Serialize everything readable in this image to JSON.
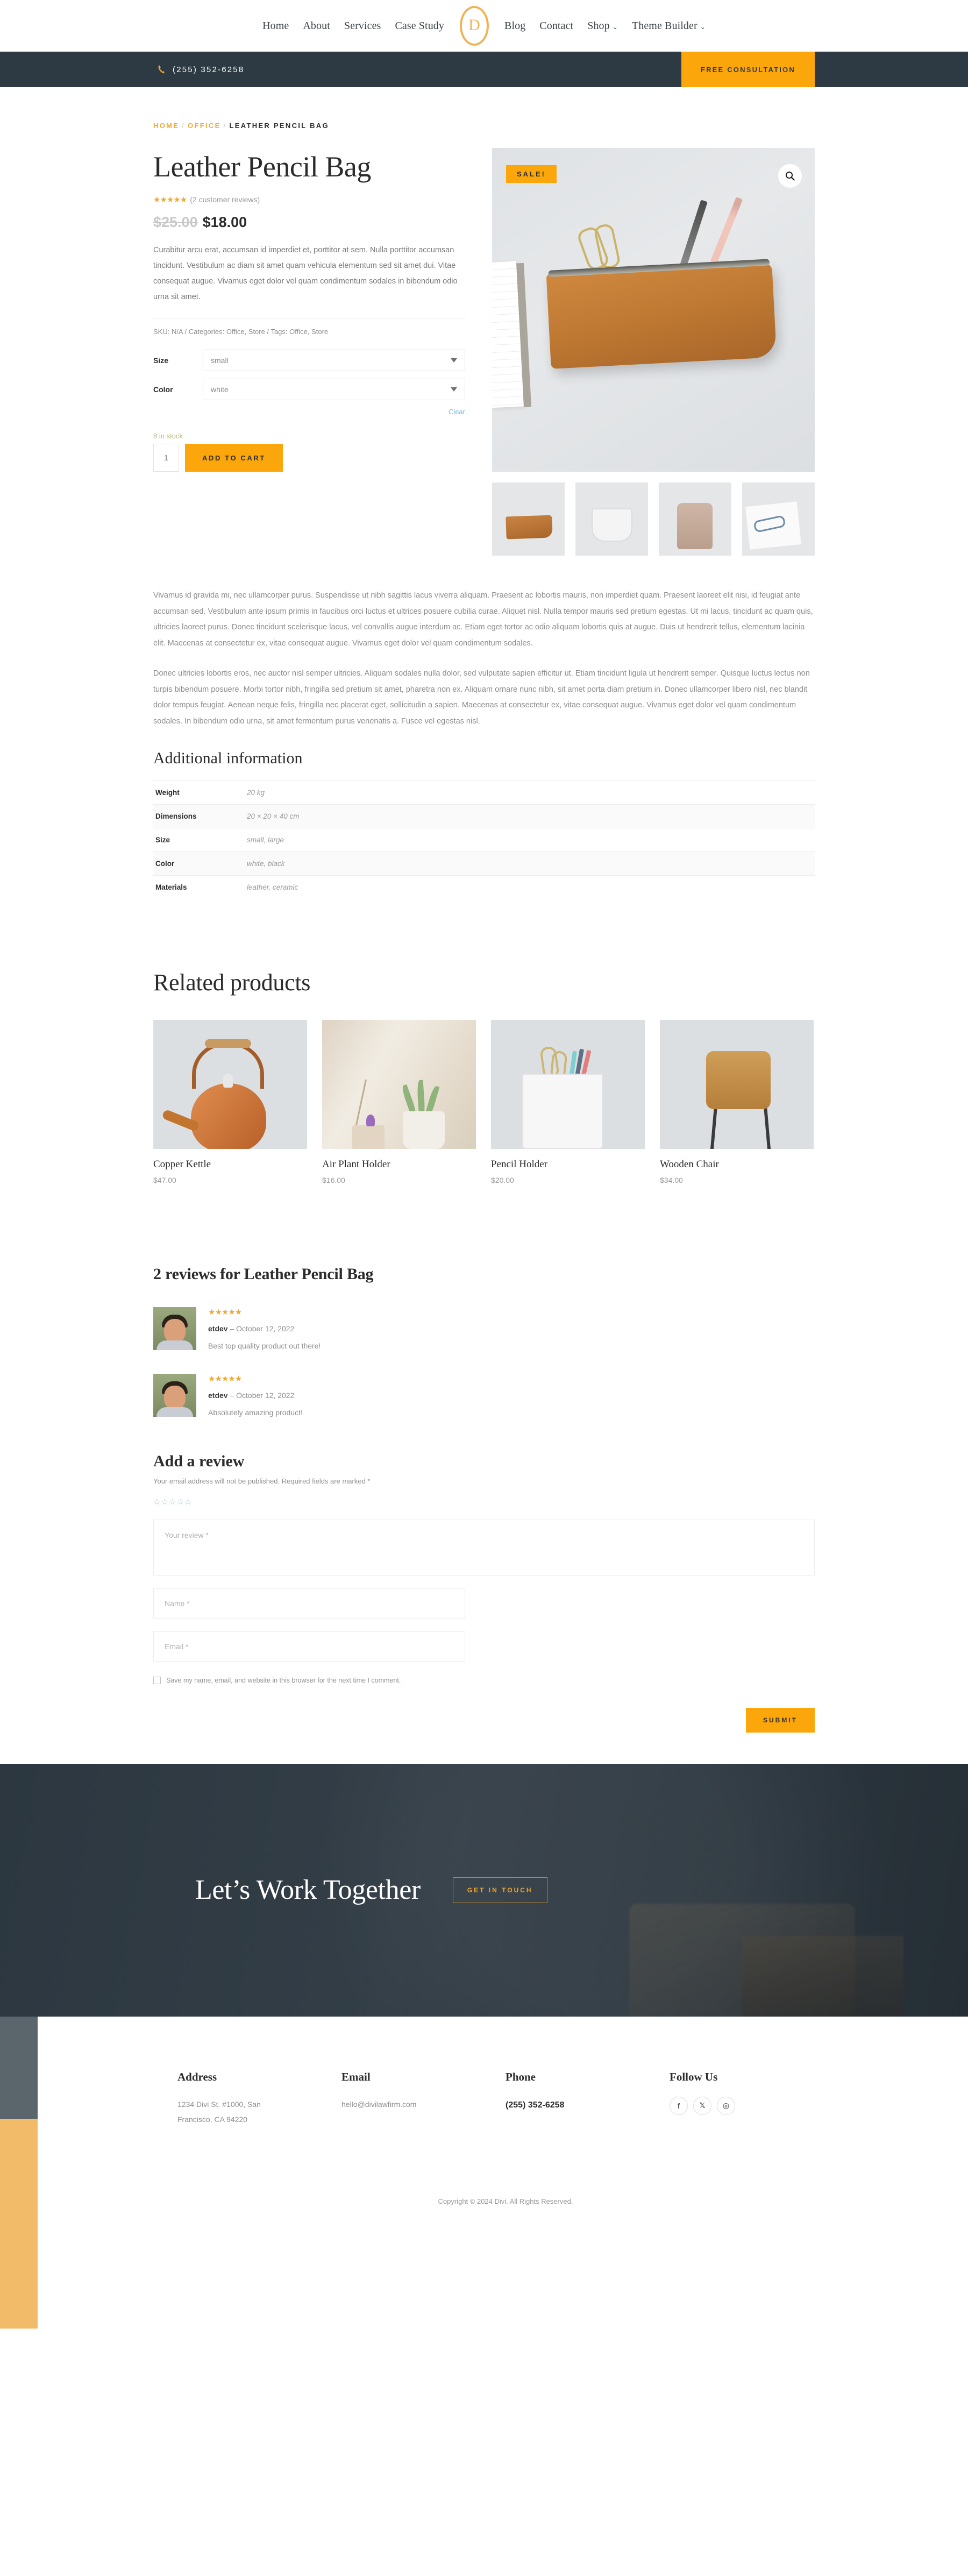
{
  "nav": {
    "items": [
      {
        "label": "Home",
        "has_caret": false
      },
      {
        "label": "About",
        "has_caret": false
      },
      {
        "label": "Services",
        "has_caret": false
      },
      {
        "label": "Case Study",
        "has_caret": false
      }
    ],
    "items_right": [
      {
        "label": "Blog",
        "has_caret": false
      },
      {
        "label": "Contact",
        "has_caret": false
      },
      {
        "label": "Shop",
        "has_caret": true
      },
      {
        "label": "Theme Builder",
        "has_caret": true
      }
    ],
    "logo_letter": "D"
  },
  "contactbar": {
    "phone": "(255) 352-6258",
    "cta_label": "FREE CONSULTATION"
  },
  "breadcrumb": {
    "home": "HOME",
    "category": "OFFICE",
    "current": "LEATHER PENCIL BAG",
    "separator": "/"
  },
  "product": {
    "title": "Leather Pencil Bag",
    "stars": "★★★★★",
    "review_count_label": "(2 customer reviews)",
    "price_old": "$25.00",
    "price_new": "$18.00",
    "short_description": "Curabitur arcu erat, accumsan id imperdiet et, porttitor at sem. Nulla porttitor accumsan tincidunt. Vestibulum ac diam sit amet quam vehicula elementum sed sit amet dui. Vitae consequat augue. Vivamus eget dolor vel quam condimentum sodales in bibendum odio urna sit amet.",
    "meta": "SKU: N/A / Categories: Office, Store / Tags: Office, Store",
    "sale_badge": "SALE!",
    "variations": [
      {
        "label": "Size",
        "value": "small"
      },
      {
        "label": "Color",
        "value": "white"
      }
    ],
    "clear_label": "Clear",
    "stock": "8 in stock",
    "quantity": "1",
    "add_to_cart_label": "ADD TO CART",
    "description_p1": "Vivamus id gravida mi, nec ullamcorper purus. Suspendisse ut nibh sagittis lacus viverra aliquam. Praesent ac lobortis mauris, non imperdiet quam. Praesent laoreet elit nisi, id feugiat ante accumsan sed. Vestibulum ante ipsum primis in faucibus orci luctus et ultrices posuere cubilia curae. Aliquet nisl. Nulla tempor mauris sed pretium egestas. Ut mi lacus, tincidunt ac quam quis, ultricies laoreet purus. Donec tincidunt scelerisque lacus, vel convallis augue interdum ac. Etiam eget tortor ac odio aliquam lobortis quis at augue. Duis ut hendrerit tellus, elementum lacinia elit. Maecenas at consectetur ex, vitae consequat augue. Vivamus eget dolor vel quam condimentum sodales.",
    "description_p2": "Donec ultricies lobortis eros, nec auctor nisl semper ultricies. Aliquam sodales nulla dolor, sed vulputate sapien efficitur ut. Etiam tincidunt ligula ut hendrerit semper. Quisque luctus lectus non turpis bibendum posuere. Morbi tortor nibh, fringilla sed pretium sit amet, pharetra non ex. Aliquam ornare nunc nibh, sit amet porta diam pretium in. Donec ullamcorper libero nisl, nec blandit dolor tempus feugiat. Aenean neque felis, fringilla nec placerat eget, sollicitudin a sapien. Maecenas at consectetur ex, vitae consequat augue. Vivamus eget dolor vel quam condimentum sodales. In bibendum odio urna, sit amet fermentum purus venenatis a. Fusce vel egestas nisl."
  },
  "additional_info": {
    "heading": "Additional information",
    "rows": [
      {
        "label": "Weight",
        "value": "20 kg"
      },
      {
        "label": "Dimensions",
        "value": "20 × 20 × 40 cm"
      },
      {
        "label": "Size",
        "value": "small, large"
      },
      {
        "label": "Color",
        "value": "white, black"
      },
      {
        "label": "Materials",
        "value": "leather, ceramic"
      }
    ]
  },
  "related": {
    "heading": "Related products",
    "items": [
      {
        "name": "Copper Kettle",
        "price": "$47.00"
      },
      {
        "name": "Air Plant Holder",
        "price": "$16.00"
      },
      {
        "name": "Pencil Holder",
        "price": "$20.00"
      },
      {
        "name": "Wooden Chair",
        "price": "$34.00"
      }
    ]
  },
  "reviews": {
    "heading": "2 reviews for Leather Pencil Bag",
    "items": [
      {
        "stars": "★★★★★",
        "author": "etdev",
        "date": "– October 12, 2022",
        "text": "Best top quality product out there!"
      },
      {
        "stars": "★★★★★",
        "author": "etdev",
        "date": "– October 12, 2022",
        "text": "Absolutely amazing product!"
      }
    ]
  },
  "add_review": {
    "heading": "Add a review",
    "notice": "Your email address will not be published. Required fields are marked *",
    "rating_stars": "☆☆☆☆☆",
    "review_placeholder": "Your review *",
    "name_placeholder": "Name *",
    "email_placeholder": "Email *",
    "save_label": "Save my name, email, and website in this browser for the next time I comment.",
    "submit_label": "SUBMIT"
  },
  "cta": {
    "title": "Let’s Work Together",
    "button_label": "GET IN TOUCH"
  },
  "footer": {
    "columns": [
      {
        "heading": "Address",
        "line1": "1234 Divi St. #1000, San",
        "line2": "Francisco, CA 94220"
      },
      {
        "heading": "Email",
        "line1": "hello@divilawfirm.com",
        "line2": ""
      },
      {
        "heading": "Phone",
        "line1": "(255) 352-6258",
        "line2": ""
      },
      {
        "heading": "Follow Us",
        "line1": "",
        "line2": ""
      }
    ],
    "socials": [
      "f",
      "𝕏",
      "◎"
    ],
    "copyright": "Copyright © 2024 Divi. All Rights Reserved."
  },
  "colors": {
    "accent": "#fba70b",
    "accent_light": "#f0b357",
    "dark": "#2e3a43",
    "footer_strip_orange": "#f2bb69",
    "footer_strip_gray": "#5a656c"
  }
}
